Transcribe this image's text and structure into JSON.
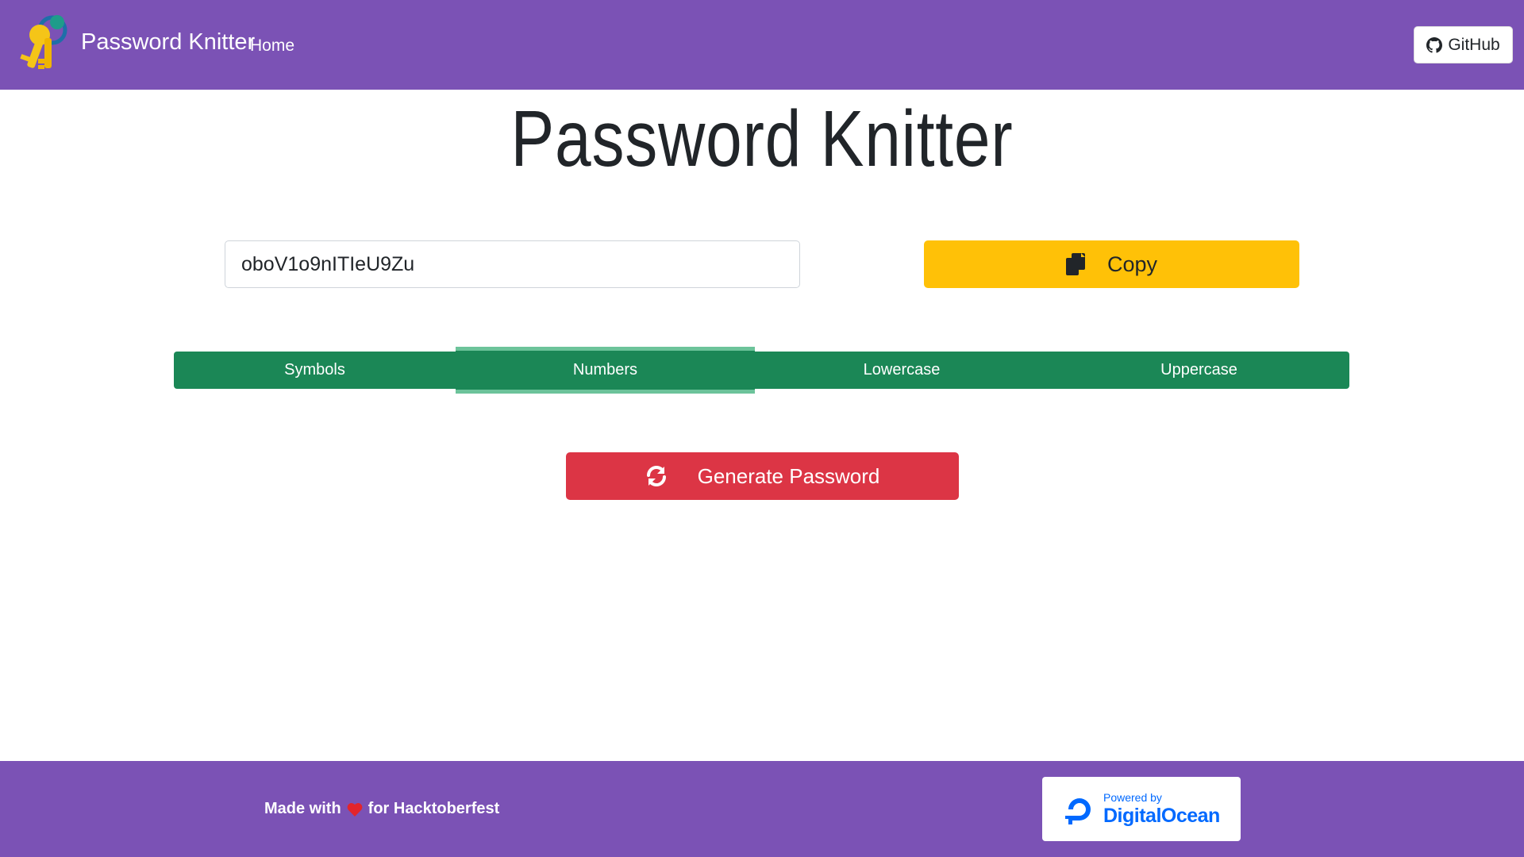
{
  "navbar": {
    "brand": "Password Knitter",
    "home_link": "Home",
    "github_label": "GitHub",
    "logo_icon": "keys-icon",
    "bg_color": "#7b52b5"
  },
  "main": {
    "title": "Password Knitter",
    "password_value": "oboV1o9nITIeU9Zu",
    "copy_label": "Copy",
    "copy_icon": "copy-icon",
    "generate_label": "Generate Password",
    "generate_icon": "refresh-icon"
  },
  "tabs": [
    {
      "label": "Symbols",
      "active": false
    },
    {
      "label": "Numbers",
      "active": true
    },
    {
      "label": "Lowercase",
      "active": false
    },
    {
      "label": "Uppercase",
      "active": false
    }
  ],
  "footer": {
    "made_with": "Made with",
    "for_text": "for Hacktoberfest",
    "heart_icon": "heart-icon",
    "do_powered_by": "Powered by",
    "do_name": "DigitalOcean"
  },
  "colors": {
    "accent_purple": "#7b52b5",
    "copy_yellow": "#ffc107",
    "tab_green": "#1b8756",
    "generate_red": "#dc3545",
    "do_blue": "#0069ff"
  }
}
